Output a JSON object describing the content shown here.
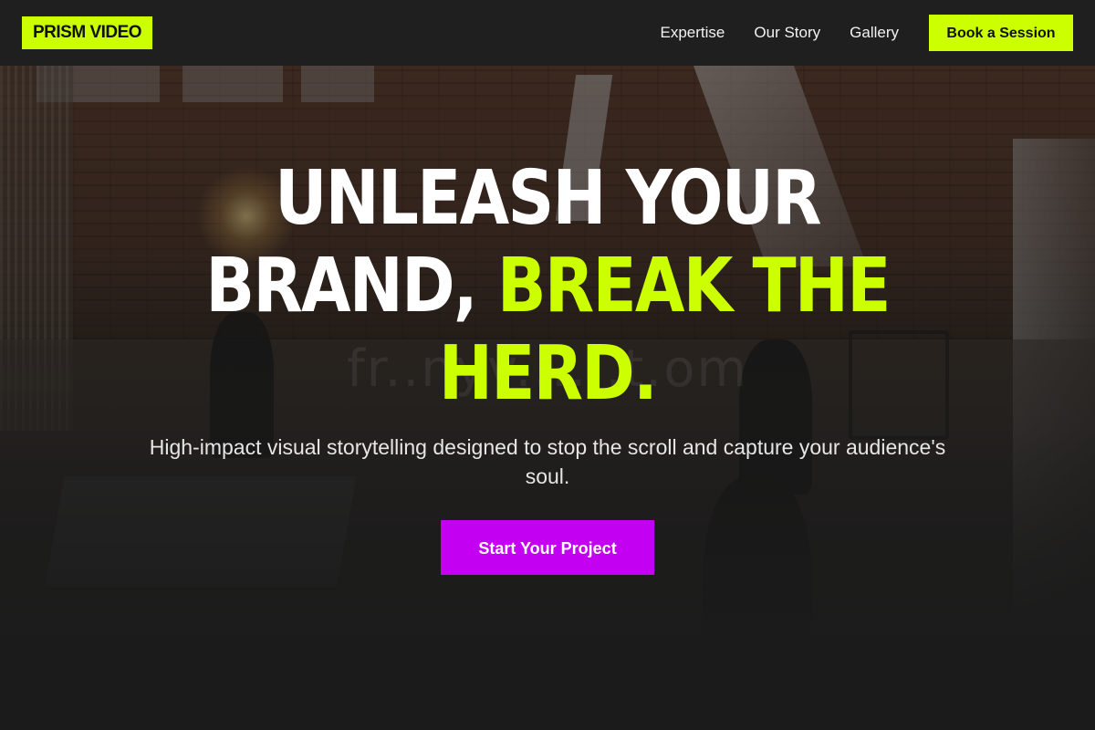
{
  "brand": {
    "logo_text": "PRISM VIDEO",
    "accent_color": "#ccff00",
    "cta_color": "#c400f2"
  },
  "nav": {
    "items": [
      {
        "label": "Expertise"
      },
      {
        "label": "Our Story"
      },
      {
        "label": "Gallery"
      }
    ],
    "book_label": "Book a Session"
  },
  "hero": {
    "headline_line1": "UNLEASH YOUR",
    "headline_line2_white": "BRAND,",
    "headline_line2_lime": "BREAK THE",
    "headline_line3_lime": "HERD.",
    "subtitle": "High-impact visual storytelling designed to stop the scroll and capture your audience's soul.",
    "cta_label": "Start Your Project",
    "watermark": "fr..nyv......t.om"
  }
}
